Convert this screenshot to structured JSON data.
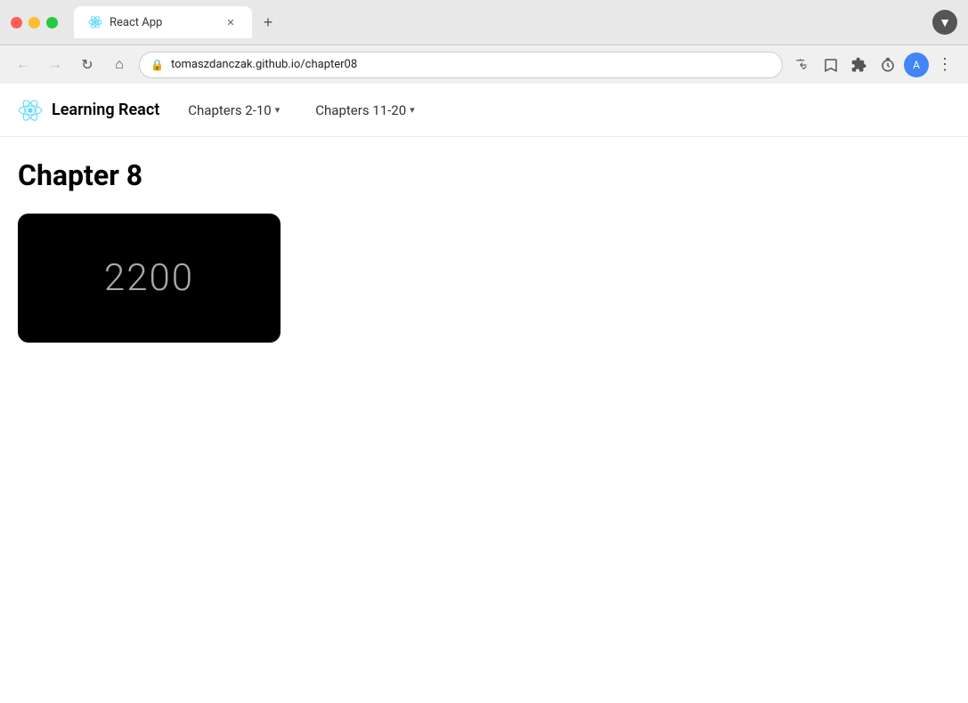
{
  "browser": {
    "tab_title": "React App",
    "url": "tomaszdanczak.github.io/chapter08",
    "new_tab_label": "+",
    "close_label": "✕"
  },
  "toolbar": {
    "back_title": "Back",
    "forward_title": "Forward",
    "reload_title": "Reload",
    "home_title": "Home"
  },
  "navbar": {
    "brand": "Learning React",
    "nav_items": [
      {
        "label": "Chapters 2-10",
        "has_dropdown": true
      },
      {
        "label": "Chapters 11-20",
        "has_dropdown": true
      }
    ]
  },
  "page": {
    "chapter_title": "Chapter 8",
    "card_number": "2200"
  }
}
